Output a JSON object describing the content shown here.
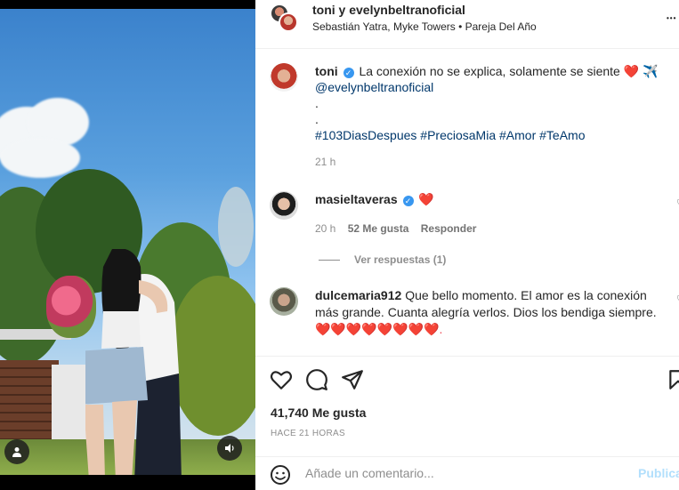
{
  "header": {
    "user1": "toni",
    "joiner": "y",
    "user2": "evelynbeltranoficial",
    "subtitle": "Sebastián Yatra, Myke Towers • Pareja Del Año",
    "more": "•••"
  },
  "caption": {
    "username": "toni",
    "text": "La conexión no se explica, solamente se siente",
    "emojis": "❤️ ✈️",
    "mention": "@evelynbeltranoficial",
    "dot1": ".",
    "dot2": ".",
    "hashtags": "#103DiasDespues #PreciosaMia #Amor #TeAmo",
    "time": "21 h"
  },
  "comments": [
    {
      "username": "masieltaveras",
      "text": "❤️",
      "time": "20 h",
      "likes": "52 Me gusta",
      "reply": "Responder"
    },
    {
      "username": "dulcemaria912",
      "text": "Que bello momento. El amor es la conexión más grande. Cuanta alegría verlos. Dios los bendiga siempre.",
      "hearts": "❤️❤️❤️❤️❤️❤️❤️❤️."
    }
  ],
  "replies": {
    "label": "Ver respuestas (1)"
  },
  "footer": {
    "likes": "41,740 Me gusta",
    "time_ago": "HACE 21 HORAS",
    "comment_placeholder": "Añade un comentario...",
    "post": "Publicar"
  },
  "colors": {
    "verified": "#3897f0",
    "heart": "#ed4956",
    "link": "#00376b",
    "post_disabled": "#b2dffc"
  }
}
